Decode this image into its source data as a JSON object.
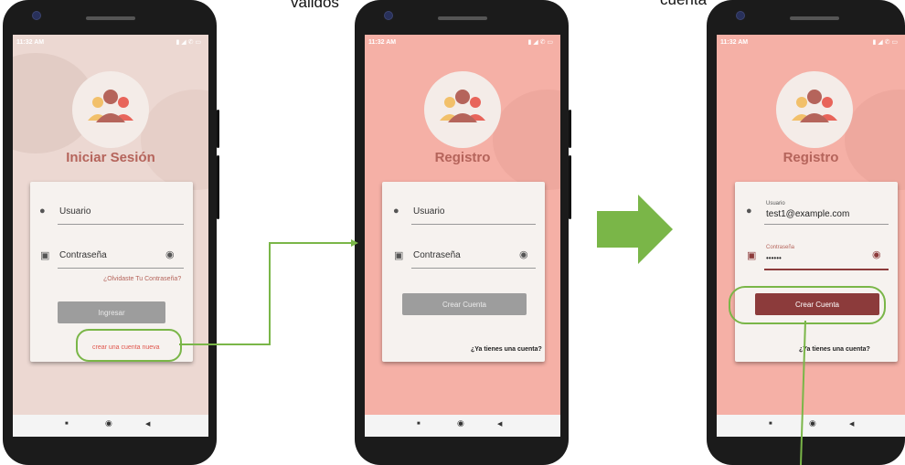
{
  "captions": {
    "middle": "validos",
    "right": "cuenta"
  },
  "status": {
    "time": "11:32 AM",
    "icons": "▮ ◢ ✆ ▭"
  },
  "login": {
    "title": "Iniciar Sesión",
    "user_label": "Usuario",
    "password_label": "Contraseña",
    "forgot": "¿Olvidaste Tu Contraseña?",
    "submit": "Ingresar",
    "create_link": "crear una cuenta nueva"
  },
  "register_empty": {
    "title": "Registro",
    "user_label": "Usuario",
    "password_label": "Contraseña",
    "submit": "Crear Cuenta",
    "have_account": "¿Ya tienes una cuenta?"
  },
  "register_filled": {
    "title": "Registro",
    "user_label": "Usuario",
    "user_value": "test1@example.com",
    "password_label": "Contraseña",
    "password_value": "••••••",
    "submit": "Crear Cuenta",
    "have_account": "¿Ya tienes una cuenta?"
  },
  "nav": {
    "recents": "■",
    "home": "◉",
    "back": "◀"
  },
  "colors": {
    "login_bg": "#ecd8d2",
    "register_bg": "#f5b0a6",
    "accent": "#b5645b",
    "button_dark": "#8c3b3b",
    "button_disabled": "#9d9d9d",
    "annotation": "#7ab648"
  }
}
